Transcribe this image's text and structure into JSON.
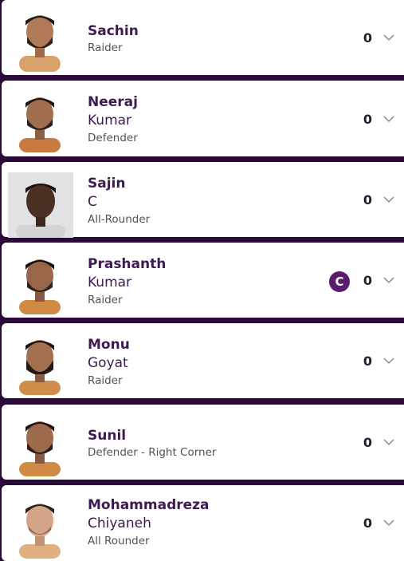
{
  "players": [
    {
      "first": "Sachin",
      "last": "",
      "role": "Raider",
      "points": "0"
    },
    {
      "first": "Neeraj",
      "last": "Kumar",
      "role": "Defender",
      "points": "0"
    },
    {
      "first": "Sajin",
      "last": "C",
      "role": "All-Rounder",
      "points": "0"
    },
    {
      "first": "Prashanth",
      "last": "Kumar",
      "role": "Raider",
      "points": "0",
      "captain": "C"
    },
    {
      "first": "Monu",
      "last": "Goyat",
      "role": "Raider",
      "points": "0"
    },
    {
      "first": "Sunil",
      "last": "",
      "role": "Defender - Right Corner",
      "points": "0"
    },
    {
      "first": "Mohammadreza",
      "last": "Chiyaneh",
      "role": "All Rounder",
      "points": "0"
    }
  ],
  "icons": {
    "expand": "chevron-down-icon",
    "avatar": "player-avatar",
    "captain_badge": "captain-badge"
  },
  "colors": {
    "accent": "#5a1d6e",
    "background": "#2a0b38",
    "name_text": "#3d1a4f"
  }
}
